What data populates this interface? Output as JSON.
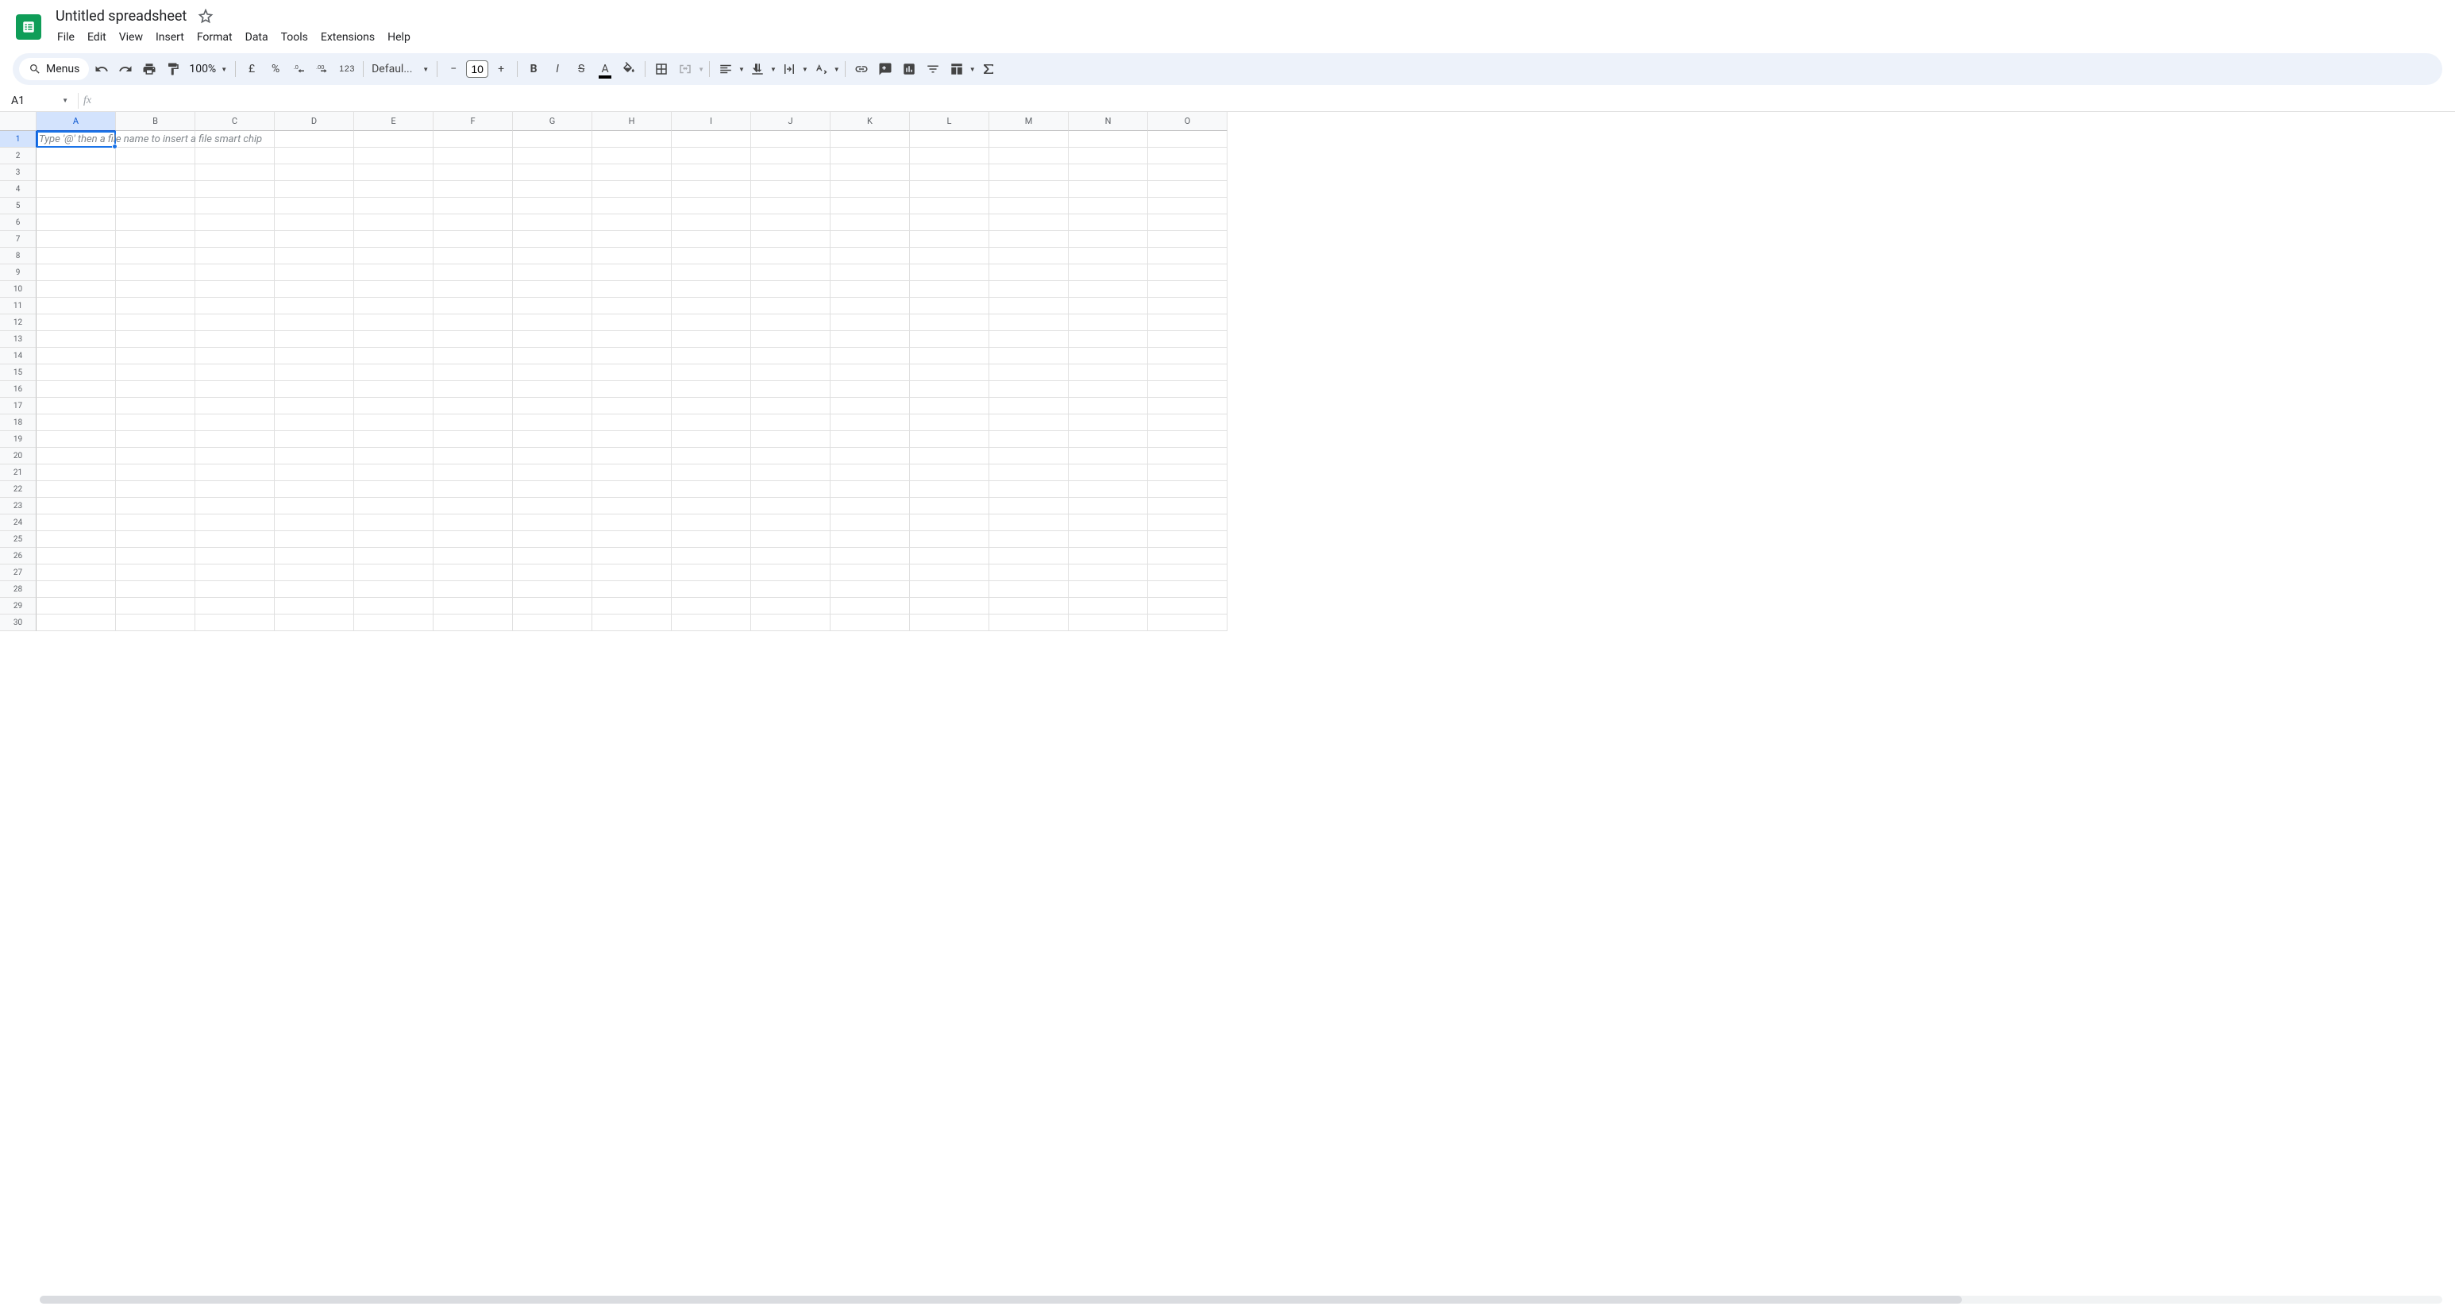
{
  "doc_title": "Untitled spreadsheet",
  "menu": [
    "File",
    "Edit",
    "View",
    "Insert",
    "Format",
    "Data",
    "Tools",
    "Extensions",
    "Help"
  ],
  "toolbar": {
    "menus_label": "Menus",
    "zoom": "100%",
    "currency": "£",
    "percent": "%",
    "numfmt": "123",
    "font": "Defaul...",
    "font_size": "10"
  },
  "name_box": "A1",
  "columns": [
    "A",
    "B",
    "C",
    "D",
    "E",
    "F",
    "G",
    "H",
    "I",
    "J",
    "K",
    "L",
    "M",
    "N",
    "O"
  ],
  "rows": [
    "1",
    "2",
    "3",
    "4",
    "5",
    "6",
    "7",
    "8",
    "9",
    "10",
    "11",
    "12",
    "13",
    "14",
    "15",
    "16",
    "17",
    "18",
    "19",
    "20",
    "21",
    "22",
    "23",
    "24",
    "25",
    "26",
    "27",
    "28",
    "29",
    "30"
  ],
  "active_cell_placeholder": "Type '@' then a file name to insert a file smart chip"
}
